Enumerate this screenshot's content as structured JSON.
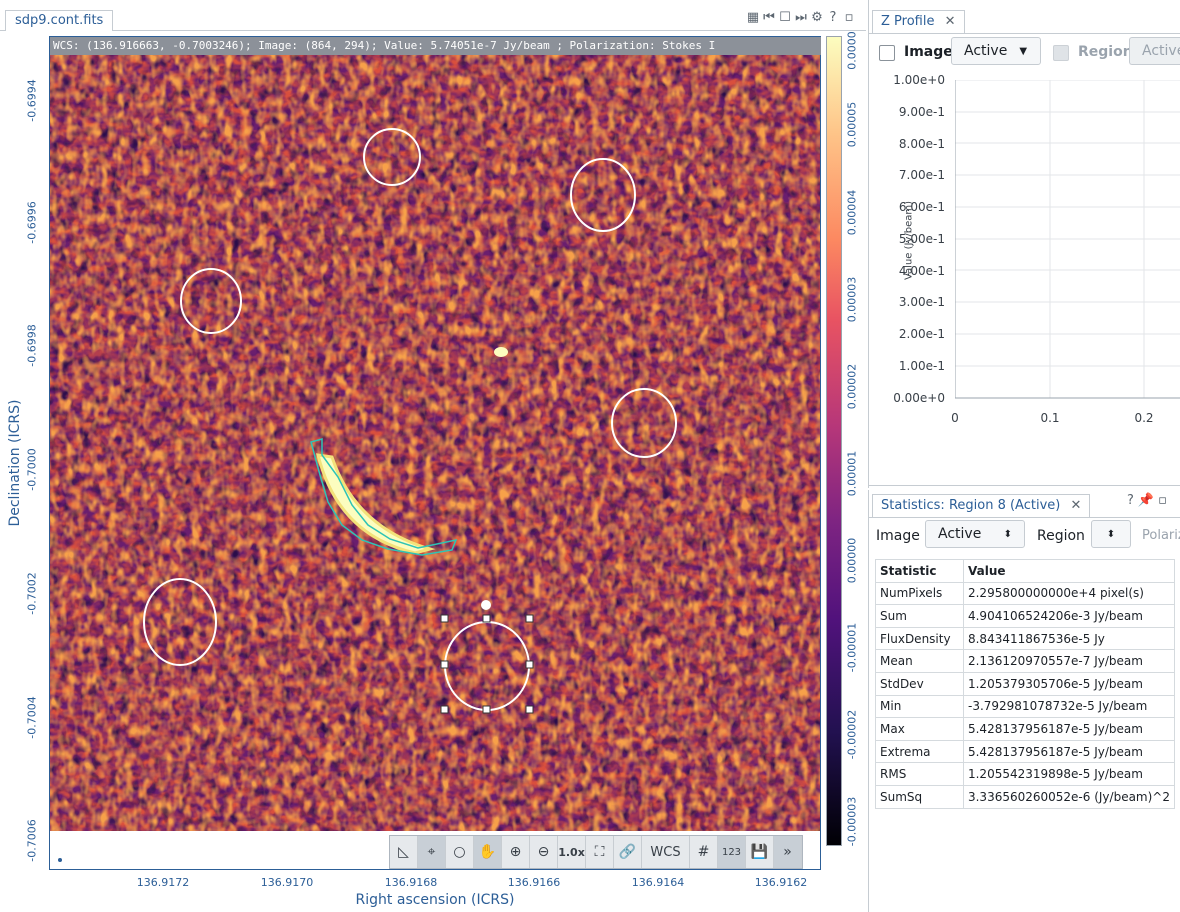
{
  "viewer": {
    "tab_title": "sdp9.cont.fits",
    "cursor_info": "WCS: (136.916663, -0.7003246); Image: (864, 294); Value:  5.74051e-7 Jy/beam ; Polarization: Stokes I",
    "y_axis_label": "Declination (ICRS)",
    "x_axis_label": "Right ascension (ICRS)",
    "y_ticks": [
      "-0.6994",
      "-0.6996",
      "-0.6998",
      "-0.7000",
      "-0.7002",
      "-0.7004",
      "-0.7006"
    ],
    "x_ticks": [
      "136.9172",
      "136.9170",
      "136.9168",
      "136.9166",
      "136.9164",
      "136.9162"
    ],
    "colorbar_ticks": [
      "0.0000",
      "0.00005",
      "0.00004",
      "0.00003",
      "0.00002",
      "0.00001",
      "0.00000",
      "-0.00001",
      "-0.00002",
      "-0.00003"
    ],
    "toolbar": {
      "zoom_label": "1.0x",
      "wcs_label": "WCS",
      "overlay_label": "123"
    }
  },
  "zprofile": {
    "tab_title": "Z Profile",
    "image_label": "Image",
    "image_select": "Active",
    "region_label": "Region",
    "region_select": "Active",
    "y_axis_label": "Value (Jy/beam)",
    "y_ticks": [
      "1.00e+0",
      "9.00e-1",
      "8.00e-1",
      "7.00e-1",
      "6.00e-1",
      "5.00e-1",
      "4.00e-1",
      "3.00e-1",
      "2.00e-1",
      "1.00e-1",
      "0.00e+0"
    ],
    "x_ticks": [
      "0",
      "0.1",
      "0.2"
    ]
  },
  "stats": {
    "tab_title": "Statistics: Region 8 (Active)",
    "image_label": "Image",
    "image_select": "Active",
    "region_label": "Region",
    "polarization_label": "Polariz",
    "headers": [
      "Statistic",
      "Value"
    ],
    "rows": [
      {
        "name": "NumPixels",
        "value": "2.295800000000e+4 pixel(s)"
      },
      {
        "name": "Sum",
        "value": "4.904106524206e-3 Jy/beam"
      },
      {
        "name": "FluxDensity",
        "value": "8.843411867536e-5 Jy"
      },
      {
        "name": "Mean",
        "value": "2.136120970557e-7 Jy/beam"
      },
      {
        "name": "StdDev",
        "value": "1.205379305706e-5 Jy/beam"
      },
      {
        "name": "Min",
        "value": "-3.792981078732e-5 Jy/beam"
      },
      {
        "name": "Max",
        "value": "5.428137956187e-5 Jy/beam"
      },
      {
        "name": "Extrema",
        "value": "5.428137956187e-5 Jy/beam"
      },
      {
        "name": "RMS",
        "value": "1.205542319898e-5 Jy/beam"
      },
      {
        "name": "SumSq",
        "value": "3.336560260052e-6 (Jy/beam)^2"
      }
    ]
  }
}
